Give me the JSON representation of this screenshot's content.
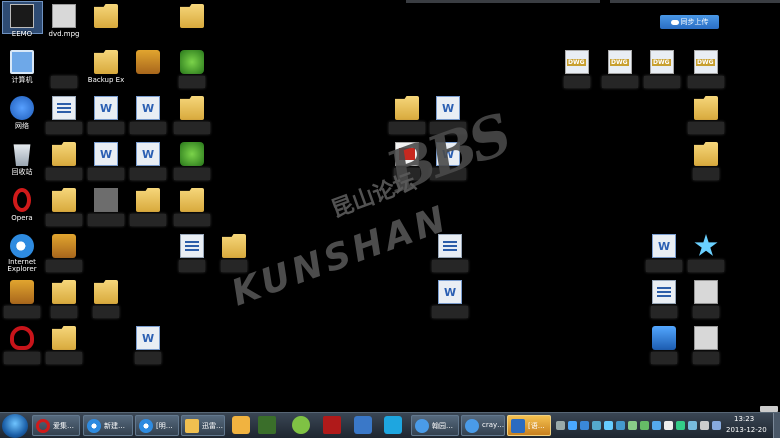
{
  "desktop": {
    "eemo_label": "EEMO",
    "dvd_label": "dvd.mpg",
    "computer_label": "计算机",
    "network_label": "网络",
    "recycle_label": "回收站",
    "opera_label": "Opera",
    "ie_label_1": "Internet",
    "ie_label_2": "Explorer",
    "backup_label": "Backup Ex",
    "upload_label": "同步上传"
  },
  "watermark": {
    "chinese": "昆山论坛",
    "bbs": "BBS",
    "kunshan": "KUNSHAN"
  },
  "taskbar": {
    "tasks": [
      {
        "label": "爱集…"
      },
      {
        "label": "新建…"
      },
      {
        "label": "[明…"
      },
      {
        "label": "迅雷…"
      },
      {
        "label": "翰园…"
      },
      {
        "label": "cray…"
      },
      {
        "label": "[语…"
      }
    ],
    "time": "13:23",
    "date": "2013-12-20"
  },
  "icons": {
    "folder": "folder-icon",
    "document": "document-icon",
    "word": "word-document-icon",
    "dwg": "dwg-file-icon",
    "pdf": "pdf-file-icon",
    "computer": "computer-icon",
    "network": "network-icon",
    "recycle": "recycle-bin-icon",
    "opera": "opera-icon",
    "ie": "internet-explorer-icon"
  },
  "colors": {
    "desktop_bg": "#000000",
    "taskbar": "#2a3440",
    "upload_button": "#3a86d8",
    "watermark": "#555555"
  }
}
